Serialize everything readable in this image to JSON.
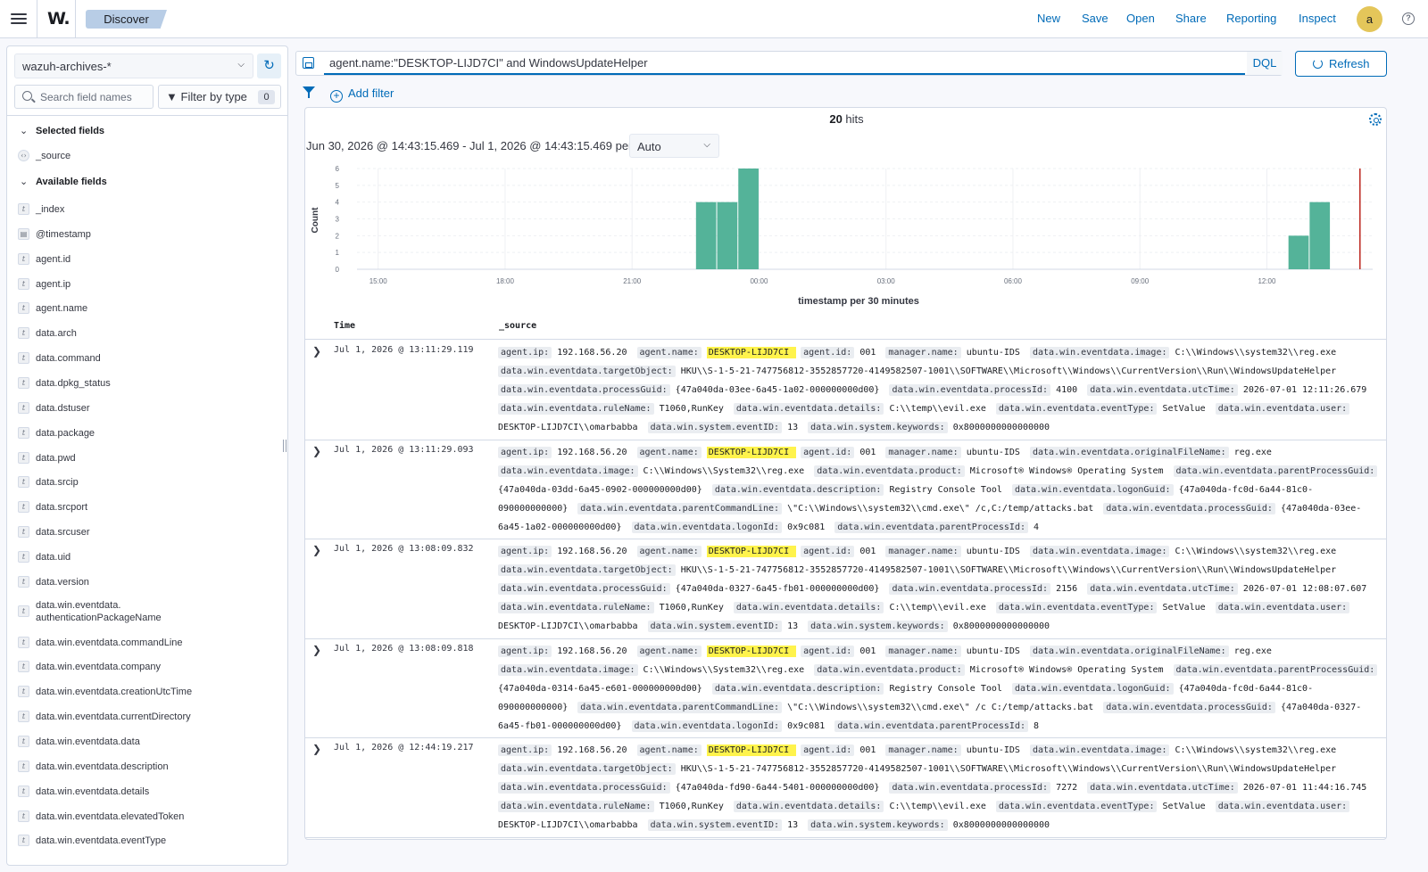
{
  "header": {
    "app_logo": "W.",
    "breadcrumb": "Discover",
    "nav": [
      "New",
      "Save",
      "Open",
      "Share",
      "Reporting",
      "Inspect"
    ],
    "avatar_letter": "a",
    "help_icon": "?"
  },
  "sidebar": {
    "index_pattern": "wazuh-archives-*",
    "search_placeholder": "Search field names",
    "filter_by_type_label": "Filter by type",
    "filter_count": "0",
    "selected_fields_label": "Selected fields",
    "available_fields_label": "Available fields",
    "selected_fields": [
      {
        "type": "source",
        "name": "_source"
      }
    ],
    "available_fields": [
      {
        "type": "t",
        "name": "_index"
      },
      {
        "type": "date",
        "name": "@timestamp"
      },
      {
        "type": "t",
        "name": "agent.id"
      },
      {
        "type": "t",
        "name": "agent.ip"
      },
      {
        "type": "t",
        "name": "agent.name"
      },
      {
        "type": "t",
        "name": "data.arch"
      },
      {
        "type": "t",
        "name": "data.command"
      },
      {
        "type": "t",
        "name": "data.dpkg_status"
      },
      {
        "type": "t",
        "name": "data.dstuser"
      },
      {
        "type": "t",
        "name": "data.package"
      },
      {
        "type": "t",
        "name": "data.pwd"
      },
      {
        "type": "t",
        "name": "data.srcip"
      },
      {
        "type": "t",
        "name": "data.srcport"
      },
      {
        "type": "t",
        "name": "data.srcuser"
      },
      {
        "type": "t",
        "name": "data.uid"
      },
      {
        "type": "t",
        "name": "data.version"
      },
      {
        "type": "t",
        "name": "data.win.eventdata.\nauthenticationPackageName"
      },
      {
        "type": "t",
        "name": "data.win.eventdata.commandLine"
      },
      {
        "type": "t",
        "name": "data.win.eventdata.company"
      },
      {
        "type": "t",
        "name": "data.win.eventdata.creationUtcTime"
      },
      {
        "type": "t",
        "name": "data.win.eventdata.currentDirectory"
      },
      {
        "type": "t",
        "name": "data.win.eventdata.data"
      },
      {
        "type": "t",
        "name": "data.win.eventdata.description"
      },
      {
        "type": "t",
        "name": "data.win.eventdata.details"
      },
      {
        "type": "t",
        "name": "data.win.eventdata.elevatedToken"
      },
      {
        "type": "t",
        "name": "data.win.eventdata.eventType"
      }
    ]
  },
  "query": {
    "text": "agent.name:\"DESKTOP-LIJD7CI\" and WindowsUpdateHelper",
    "language": "DQL",
    "refresh_label": "Refresh",
    "add_filter_label": "Add filter"
  },
  "results": {
    "hits_count": "20",
    "hits_label": " hits",
    "date_range": "Jun 30, 2026 @ 14:43:15.469 - Jul 1, 2026 @ 14:43:15.469 per",
    "interval": "Auto",
    "col_time": "Time",
    "col_source": "_source"
  },
  "chart_data": {
    "type": "bar",
    "ylabel": "Count",
    "xlabel": "timestamp per 30 minutes",
    "ylim": [
      0,
      6
    ],
    "yticks": [
      0,
      1,
      2,
      3,
      4,
      5,
      6
    ],
    "xtick_labels": [
      "15:00",
      "18:00",
      "21:00",
      "00:00",
      "03:00",
      "06:00",
      "09:00",
      "12:00"
    ],
    "x_start_hour": 14.5,
    "x_end_hour": 38.5,
    "bar_width_hours": 0.5,
    "bars": [
      {
        "start_hour": 22.5,
        "value": 4
      },
      {
        "start_hour": 23.0,
        "value": 4
      },
      {
        "start_hour": 23.5,
        "value": 6
      },
      {
        "start_hour": 36.5,
        "value": 2
      },
      {
        "start_hour": 37.0,
        "value": 4
      }
    ],
    "current_time_hour": 38.2,
    "bar_color": "#54b399",
    "now_line_color": "#bd271e",
    "grid": true
  },
  "documents": [
    {
      "time": "Jul 1, 2026 @ 13:11:29.119",
      "fields": [
        [
          "agent.ip:",
          "192.168.56.20"
        ],
        [
          "agent.name:",
          "DESKTOP-LIJD7CI",
          true
        ],
        [
          "agent.id:",
          "001"
        ],
        [
          "manager.name:",
          "ubuntu-IDS"
        ],
        [
          "data.win.eventdata.image:",
          "C:\\\\Windows\\\\system32\\\\reg.exe"
        ],
        [
          "data.win.eventdata.targetObject:",
          "HKU\\\\S-1-5-21-747756812-3552857720-4149582507-1001\\\\SOFTWARE\\\\Microsoft\\\\Windows\\\\CurrentVersion\\\\Run\\\\WindowsUpdateHelper"
        ],
        [
          "data.win.eventdata.processGuid:",
          "{47a040da-03ee-6a45-1a02-000000000d00}"
        ],
        [
          "data.win.eventdata.processId:",
          "4100"
        ],
        [
          "data.win.eventdata.utcTime:",
          "2026-07-01 12:11:26.679"
        ],
        [
          "data.win.eventdata.ruleName:",
          "T1060,RunKey"
        ],
        [
          "data.win.eventdata.details:",
          "C:\\\\temp\\\\evil.exe"
        ],
        [
          "data.win.eventdata.eventType:",
          "SetValue"
        ],
        [
          "data.win.eventdata.user:",
          "DESKTOP-LIJD7CI\\\\omarbabba"
        ],
        [
          "data.win.system.eventID:",
          "13"
        ],
        [
          "data.win.system.keywords:",
          "0x8000000000000000"
        ]
      ]
    },
    {
      "time": "Jul 1, 2026 @ 13:11:29.093",
      "fields": [
        [
          "agent.ip:",
          "192.168.56.20"
        ],
        [
          "agent.name:",
          "DESKTOP-LIJD7CI",
          true
        ],
        [
          "agent.id:",
          "001"
        ],
        [
          "manager.name:",
          "ubuntu-IDS"
        ],
        [
          "data.win.eventdata.originalFileName:",
          "reg.exe"
        ],
        [
          "data.win.eventdata.image:",
          "C:\\\\Windows\\\\System32\\\\reg.exe"
        ],
        [
          "data.win.eventdata.product:",
          "Microsoft® Windows® Operating System"
        ],
        [
          "data.win.eventdata.parentProcessGuid:",
          "{47a040da-03dd-6a45-0902-000000000d00}"
        ],
        [
          "data.win.eventdata.description:",
          "Registry Console Tool"
        ],
        [
          "data.win.eventdata.logonGuid:",
          "{47a040da-fc0d-6a44-81c0-090000000000}"
        ],
        [
          "data.win.eventdata.parentCommandLine:",
          "\\\"C:\\\\Windows\\\\system32\\\\cmd.exe\\\" /c,C:/temp/attacks.bat"
        ],
        [
          "data.win.eventdata.processGuid:",
          "{47a040da-03ee-6a45-1a02-000000000d00}"
        ],
        [
          "data.win.eventdata.logonId:",
          "0x9c081"
        ],
        [
          "data.win.eventdata.parentProcessId:",
          "4"
        ]
      ]
    },
    {
      "time": "Jul 1, 2026 @ 13:08:09.832",
      "fields": [
        [
          "agent.ip:",
          "192.168.56.20"
        ],
        [
          "agent.name:",
          "DESKTOP-LIJD7CI",
          true
        ],
        [
          "agent.id:",
          "001"
        ],
        [
          "manager.name:",
          "ubuntu-IDS"
        ],
        [
          "data.win.eventdata.image:",
          "C:\\\\Windows\\\\system32\\\\reg.exe"
        ],
        [
          "data.win.eventdata.targetObject:",
          "HKU\\\\S-1-5-21-747756812-3552857720-4149582507-1001\\\\SOFTWARE\\\\Microsoft\\\\Windows\\\\CurrentVersion\\\\Run\\\\WindowsUpdateHelper"
        ],
        [
          "data.win.eventdata.processGuid:",
          "{47a040da-0327-6a45-fb01-000000000d00}"
        ],
        [
          "data.win.eventdata.processId:",
          "2156"
        ],
        [
          "data.win.eventdata.utcTime:",
          "2026-07-01 12:08:07.607"
        ],
        [
          "data.win.eventdata.ruleName:",
          "T1060,RunKey"
        ],
        [
          "data.win.eventdata.details:",
          "C:\\\\temp\\\\evil.exe"
        ],
        [
          "data.win.eventdata.eventType:",
          "SetValue"
        ],
        [
          "data.win.eventdata.user:",
          "DESKTOP-LIJD7CI\\\\omarbabba"
        ],
        [
          "data.win.system.eventID:",
          "13"
        ],
        [
          "data.win.system.keywords:",
          "0x8000000000000000"
        ]
      ]
    },
    {
      "time": "Jul 1, 2026 @ 13:08:09.818",
      "fields": [
        [
          "agent.ip:",
          "192.168.56.20"
        ],
        [
          "agent.name:",
          "DESKTOP-LIJD7CI",
          true
        ],
        [
          "agent.id:",
          "001"
        ],
        [
          "manager.name:",
          "ubuntu-IDS"
        ],
        [
          "data.win.eventdata.originalFileName:",
          "reg.exe"
        ],
        [
          "data.win.eventdata.image:",
          "C:\\\\Windows\\\\System32\\\\reg.exe"
        ],
        [
          "data.win.eventdata.product:",
          "Microsoft® Windows® Operating System"
        ],
        [
          "data.win.eventdata.parentProcessGuid:",
          "{47a040da-0314-6a45-e601-000000000d00}"
        ],
        [
          "data.win.eventdata.description:",
          "Registry Console Tool"
        ],
        [
          "data.win.eventdata.logonGuid:",
          "{47a040da-fc0d-6a44-81c0-090000000000}"
        ],
        [
          "data.win.eventdata.parentCommandLine:",
          "\\\"C:\\\\Windows\\\\system32\\\\cmd.exe\\\" /c C:/temp/attacks.bat"
        ],
        [
          "data.win.eventdata.processGuid:",
          "{47a040da-0327-6a45-fb01-000000000d00}"
        ],
        [
          "data.win.eventdata.logonId:",
          "0x9c081"
        ],
        [
          "data.win.eventdata.parentProcessId:",
          "8"
        ]
      ]
    },
    {
      "time": "Jul 1, 2026 @ 12:44:19.217",
      "fields": [
        [
          "agent.ip:",
          "192.168.56.20"
        ],
        [
          "agent.name:",
          "DESKTOP-LIJD7CI",
          true
        ],
        [
          "agent.id:",
          "001"
        ],
        [
          "manager.name:",
          "ubuntu-IDS"
        ],
        [
          "data.win.eventdata.image:",
          "C:\\\\Windows\\\\system32\\\\reg.exe"
        ],
        [
          "data.win.eventdata.targetObject:",
          "HKU\\\\S-1-5-21-747756812-3552857720-4149582507-1001\\\\SOFTWARE\\\\Microsoft\\\\Windows\\\\CurrentVersion\\\\Run\\\\WindowsUpdateHelper"
        ],
        [
          "data.win.eventdata.processGuid:",
          "{47a040da-fd90-6a44-5401-000000000d00}"
        ],
        [
          "data.win.eventdata.processId:",
          "7272"
        ],
        [
          "data.win.eventdata.utcTime:",
          "2026-07-01 11:44:16.745"
        ],
        [
          "data.win.eventdata.ruleName:",
          "T1060,RunKey"
        ],
        [
          "data.win.eventdata.details:",
          "C:\\\\temp\\\\evil.exe"
        ],
        [
          "data.win.eventdata.eventType:",
          "SetValue"
        ],
        [
          "data.win.eventdata.user:",
          "DESKTOP-LIJD7CI\\\\omarbabba"
        ],
        [
          "data.win.system.eventID:",
          "13"
        ],
        [
          "data.win.system.keywords:",
          "0x8000000000000000"
        ]
      ]
    }
  ]
}
